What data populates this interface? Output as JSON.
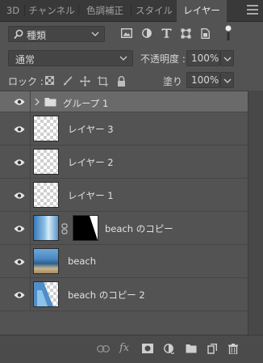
{
  "tabs": [
    {
      "label": "3D"
    },
    {
      "label": "チャンネル"
    },
    {
      "label": "色調補正"
    },
    {
      "label": "スタイル"
    },
    {
      "label": "レイヤー"
    }
  ],
  "active_tab": "レイヤー",
  "filter": {
    "kind_label": "種類"
  },
  "blend": {
    "mode": "通常",
    "opacity_label": "不透明度 :",
    "opacity_value": "100%"
  },
  "lock": {
    "label": "ロック :",
    "fill_label": "塗り :",
    "fill_value": "100%"
  },
  "layers": [
    {
      "name": "グループ 1",
      "type": "group"
    },
    {
      "name": "レイヤー 3",
      "type": "transparent"
    },
    {
      "name": "レイヤー 2",
      "type": "transparent"
    },
    {
      "name": "レイヤー 1",
      "type": "transparent"
    },
    {
      "name": "beach のコピー",
      "type": "masked"
    },
    {
      "name": "beach",
      "type": "image"
    },
    {
      "name": "beach のコピー 2",
      "type": "image-partial"
    }
  ],
  "footer": {
    "fx_label": "fx"
  },
  "colors": {
    "panel_bg": "#535353",
    "tab_bar_bg": "#393939",
    "group_row_bg": "#6a6a6a",
    "text": "#d6d6d6"
  }
}
